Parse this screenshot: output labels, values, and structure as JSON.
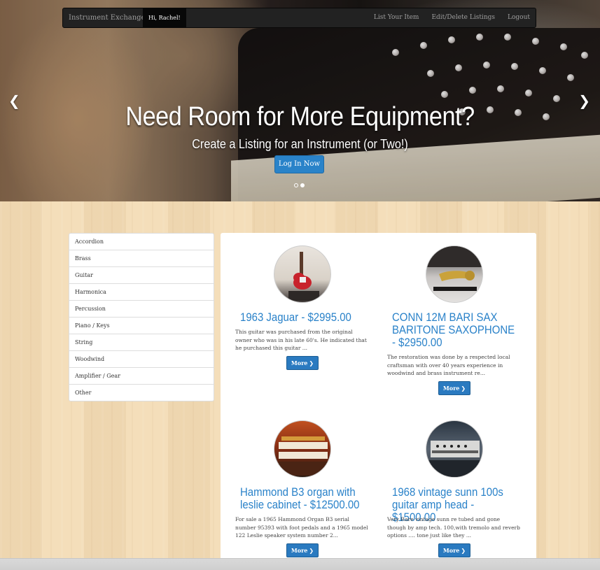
{
  "navbar": {
    "brand": "Instrument Exchange",
    "greeting": "Hi, Rachel!",
    "links": [
      "List Your Item",
      "Edit/Delete Listings",
      "Logout"
    ]
  },
  "hero": {
    "title": "Need Room for More Equipment?",
    "subtitle": "Create a Listing for an Instrument (or Two!)",
    "button": "Log In Now",
    "prev_icon": "chevron-left-icon",
    "next_icon": "chevron-right-icon",
    "slides_total": 2,
    "active_slide": 2
  },
  "categories": [
    "Accordion",
    "Brass",
    "Guitar",
    "Harmonica",
    "Percussion",
    "Piano / Keys",
    "String",
    "Woodwind",
    "Amplifier / Gear",
    "Other"
  ],
  "listings": [
    {
      "title": "1963 Jaguar - $2995.00",
      "description": "This guitar was purchased from the original owner who was in his late 60's. He indicated that he purchased this guitar ...",
      "more": "More"
    },
    {
      "title": "CONN 12M BARI SAX BARITONE SAXOPHONE - $2950.00",
      "description": "The restoration was done by a respected local craftsman with over 40 years experience in woodwind and brass instrument re...",
      "more": "More"
    },
    {
      "title": "Hammond B3 organ with leslie cabinet - $12500.00",
      "description": "For sale a 1965 Hammond Organ B3 serial number 95393 with foot pedals and a 1965 model 122 Leslie speaker system number 2...",
      "more": "More"
    },
    {
      "title": "1968 vintage sunn 100s guitar amp head - $1500.00",
      "description": "Very Rare vintage sunn re tubed and gone though by amp tech. 100,with tremolo and reverb options .... tone just like they ...",
      "more": "More"
    }
  ],
  "colors": {
    "navbar": "#222222",
    "accent": "#2a82c9",
    "button": "#2a7ac0",
    "wood": "#f2dcb7"
  }
}
